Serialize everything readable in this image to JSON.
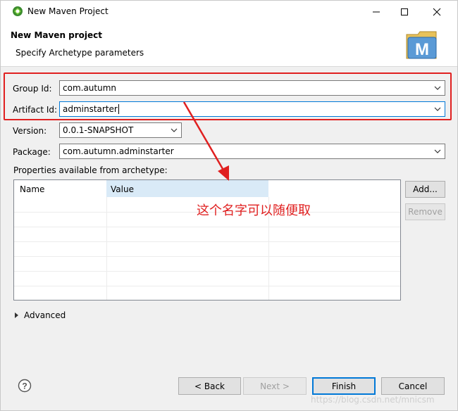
{
  "window": {
    "title": "New Maven Project"
  },
  "header": {
    "title": "New Maven project",
    "subtitle": "Specify Archetype parameters",
    "logo_letter": "M"
  },
  "form": {
    "group_id_label": "Group Id:",
    "group_id_value": "com.autumn",
    "artifact_id_label": "Artifact Id:",
    "artifact_id_value": "adminstarter",
    "version_label": "Version:",
    "version_value": "0.0.1-SNAPSHOT",
    "package_label": "Package:",
    "package_value": "com.autumn.adminstarter",
    "properties_label": "Properties available from archetype:"
  },
  "table": {
    "col_name": "Name",
    "col_value": "Value"
  },
  "side_buttons": {
    "add": "Add...",
    "remove": "Remove"
  },
  "annotation": {
    "text": "这个名字可以随便取",
    "color": "#e02020"
  },
  "advanced": {
    "label": "Advanced"
  },
  "footer": {
    "back": "< Back",
    "next": "Next >",
    "finish": "Finish",
    "cancel": "Cancel"
  },
  "watermark": {
    "text": "https://blog.csdn.net/mnicsm"
  },
  "colors": {
    "accent": "#0078d7",
    "highlight_box": "#e02020",
    "selected_header": "#d9eaf7"
  },
  "icons": {
    "app": "maven-eclipse-icon",
    "help": "help-icon",
    "dropdown": "chevron-down-icon"
  }
}
